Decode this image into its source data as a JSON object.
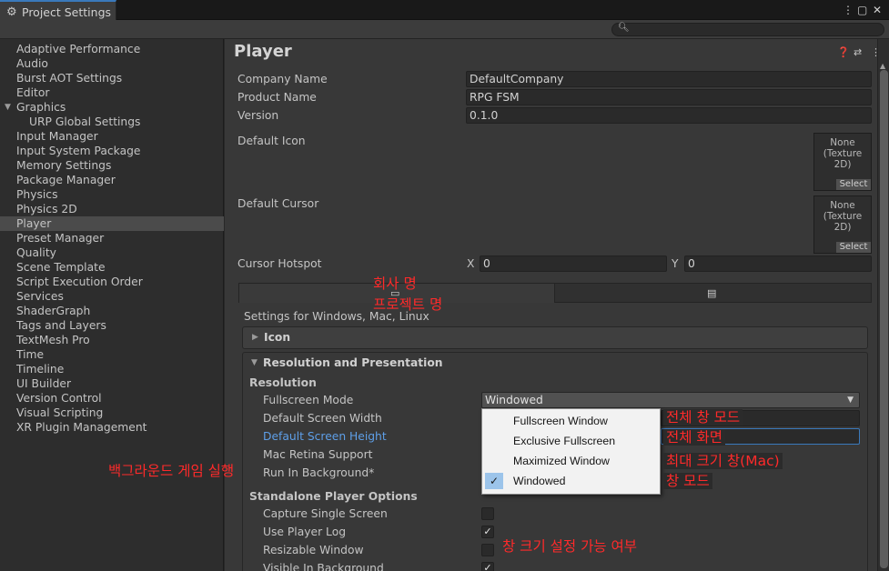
{
  "window": {
    "tab_title": "Project Settings",
    "controls": [
      "⋮",
      "▢",
      "✕"
    ]
  },
  "search": {
    "placeholder": ""
  },
  "sidebar": {
    "items": [
      {
        "label": "Adaptive Performance"
      },
      {
        "label": "Audio"
      },
      {
        "label": "Burst AOT Settings"
      },
      {
        "label": "Editor"
      },
      {
        "label": "Graphics",
        "expanded": true
      },
      {
        "label": "URP Global Settings",
        "child": true
      },
      {
        "label": "Input Manager"
      },
      {
        "label": "Input System Package"
      },
      {
        "label": "Memory Settings"
      },
      {
        "label": "Package Manager"
      },
      {
        "label": "Physics"
      },
      {
        "label": "Physics 2D"
      },
      {
        "label": "Player",
        "selected": true
      },
      {
        "label": "Preset Manager"
      },
      {
        "label": "Quality"
      },
      {
        "label": "Scene Template"
      },
      {
        "label": "Script Execution Order"
      },
      {
        "label": "Services"
      },
      {
        "label": "ShaderGraph"
      },
      {
        "label": "Tags and Layers"
      },
      {
        "label": "TextMesh Pro"
      },
      {
        "label": "Time"
      },
      {
        "label": "Timeline"
      },
      {
        "label": "UI Builder"
      },
      {
        "label": "Version Control"
      },
      {
        "label": "Visual Scripting"
      },
      {
        "label": "XR Plugin Management"
      }
    ]
  },
  "player": {
    "title": "Player",
    "company_name_label": "Company Name",
    "company_name": "DefaultCompany",
    "product_name_label": "Product Name",
    "product_name": "RPG FSM",
    "version_label": "Version",
    "version": "0.1.0",
    "default_icon_label": "Default Icon",
    "default_cursor_label": "Default Cursor",
    "texture_none": "None",
    "texture_type": "(Texture 2D)",
    "select_label": "Select",
    "cursor_hotspot_label": "Cursor Hotspot",
    "hotspot_x_label": "X",
    "hotspot_x": "0",
    "hotspot_y_label": "Y",
    "hotspot_y": "0",
    "platform_settings_label": "Settings for Windows, Mac, Linux",
    "icon_section": "Icon",
    "resolution_section": "Resolution and Presentation",
    "resolution_header": "Resolution",
    "fullscreen_mode_label": "Fullscreen Mode",
    "fullscreen_mode_value": "Windowed",
    "default_screen_width_label": "Default Screen Width",
    "default_screen_height_label": "Default Screen Height",
    "mac_retina_label": "Mac Retina Support",
    "run_in_background_label": "Run In Background*",
    "standalone_header": "Standalone Player Options",
    "capture_single_screen_label": "Capture Single Screen",
    "capture_single_screen": false,
    "use_player_log_label": "Use Player Log",
    "use_player_log": true,
    "resizable_window_label": "Resizable Window",
    "resizable_window": false,
    "visible_in_background_label": "Visible In Background",
    "visible_in_background": true
  },
  "fullscreen_menu": {
    "options": [
      {
        "label": "Fullscreen Window"
      },
      {
        "label": "Exclusive Fullscreen"
      },
      {
        "label": "Maximized Window"
      },
      {
        "label": "Windowed",
        "checked": true
      }
    ]
  },
  "annotations": {
    "company": "회사 명",
    "product": "프로젝트 명",
    "fullscreen_window": "전체 창 모드",
    "exclusive_fullscreen": "전체 화면",
    "maximized_window": "최대 크기 창(Mac)",
    "windowed": "창 모드",
    "run_in_background": "백그라운드 게임 실행",
    "resizable_window": "창 크기 설정 가능 여부"
  },
  "colors": {
    "accent": "#3a79bb",
    "highlight_label": "#5e9fe8",
    "annotation": "#ff2a2a"
  }
}
